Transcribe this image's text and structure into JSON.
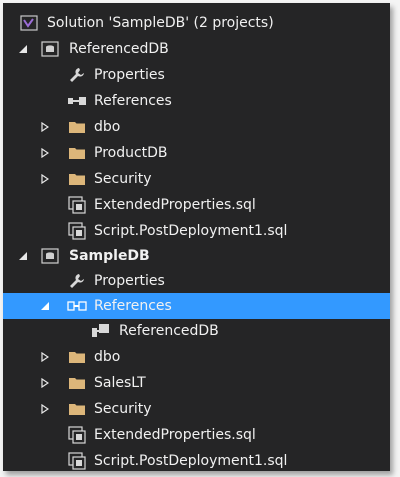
{
  "solution": {
    "label": "Solution 'SampleDB' (2 projects)"
  },
  "projects": [
    {
      "name": "ReferencedDB",
      "items": [
        {
          "label": "Properties",
          "icon": "wrench-icon"
        },
        {
          "label": "References",
          "icon": "references-icon"
        },
        {
          "label": "dbo",
          "icon": "folder-icon"
        },
        {
          "label": "ProductDB",
          "icon": "folder-icon"
        },
        {
          "label": "Security",
          "icon": "folder-icon"
        },
        {
          "label": "ExtendedProperties.sql",
          "icon": "sql-file-icon"
        },
        {
          "label": "Script.PostDeployment1.sql",
          "icon": "sql-file-icon"
        }
      ]
    },
    {
      "name": "SampleDB",
      "items": [
        {
          "label": "Properties",
          "icon": "wrench-icon"
        },
        {
          "label": "References",
          "icon": "references-icon",
          "selected": true
        },
        {
          "label": "ReferencedDB",
          "icon": "database-reference-icon"
        },
        {
          "label": "dbo",
          "icon": "folder-icon"
        },
        {
          "label": "SalesLT",
          "icon": "folder-icon"
        },
        {
          "label": "Security",
          "icon": "folder-icon"
        },
        {
          "label": "ExtendedProperties.sql",
          "icon": "sql-file-icon"
        },
        {
          "label": "Script.PostDeployment1.sql",
          "icon": "sql-file-icon"
        }
      ]
    }
  ],
  "colors": {
    "background": "#252526",
    "text": "#f1f1f1",
    "selection": "#3399ff",
    "folder": "#dcb67a",
    "solution_icon": "#9b6dd6"
  }
}
